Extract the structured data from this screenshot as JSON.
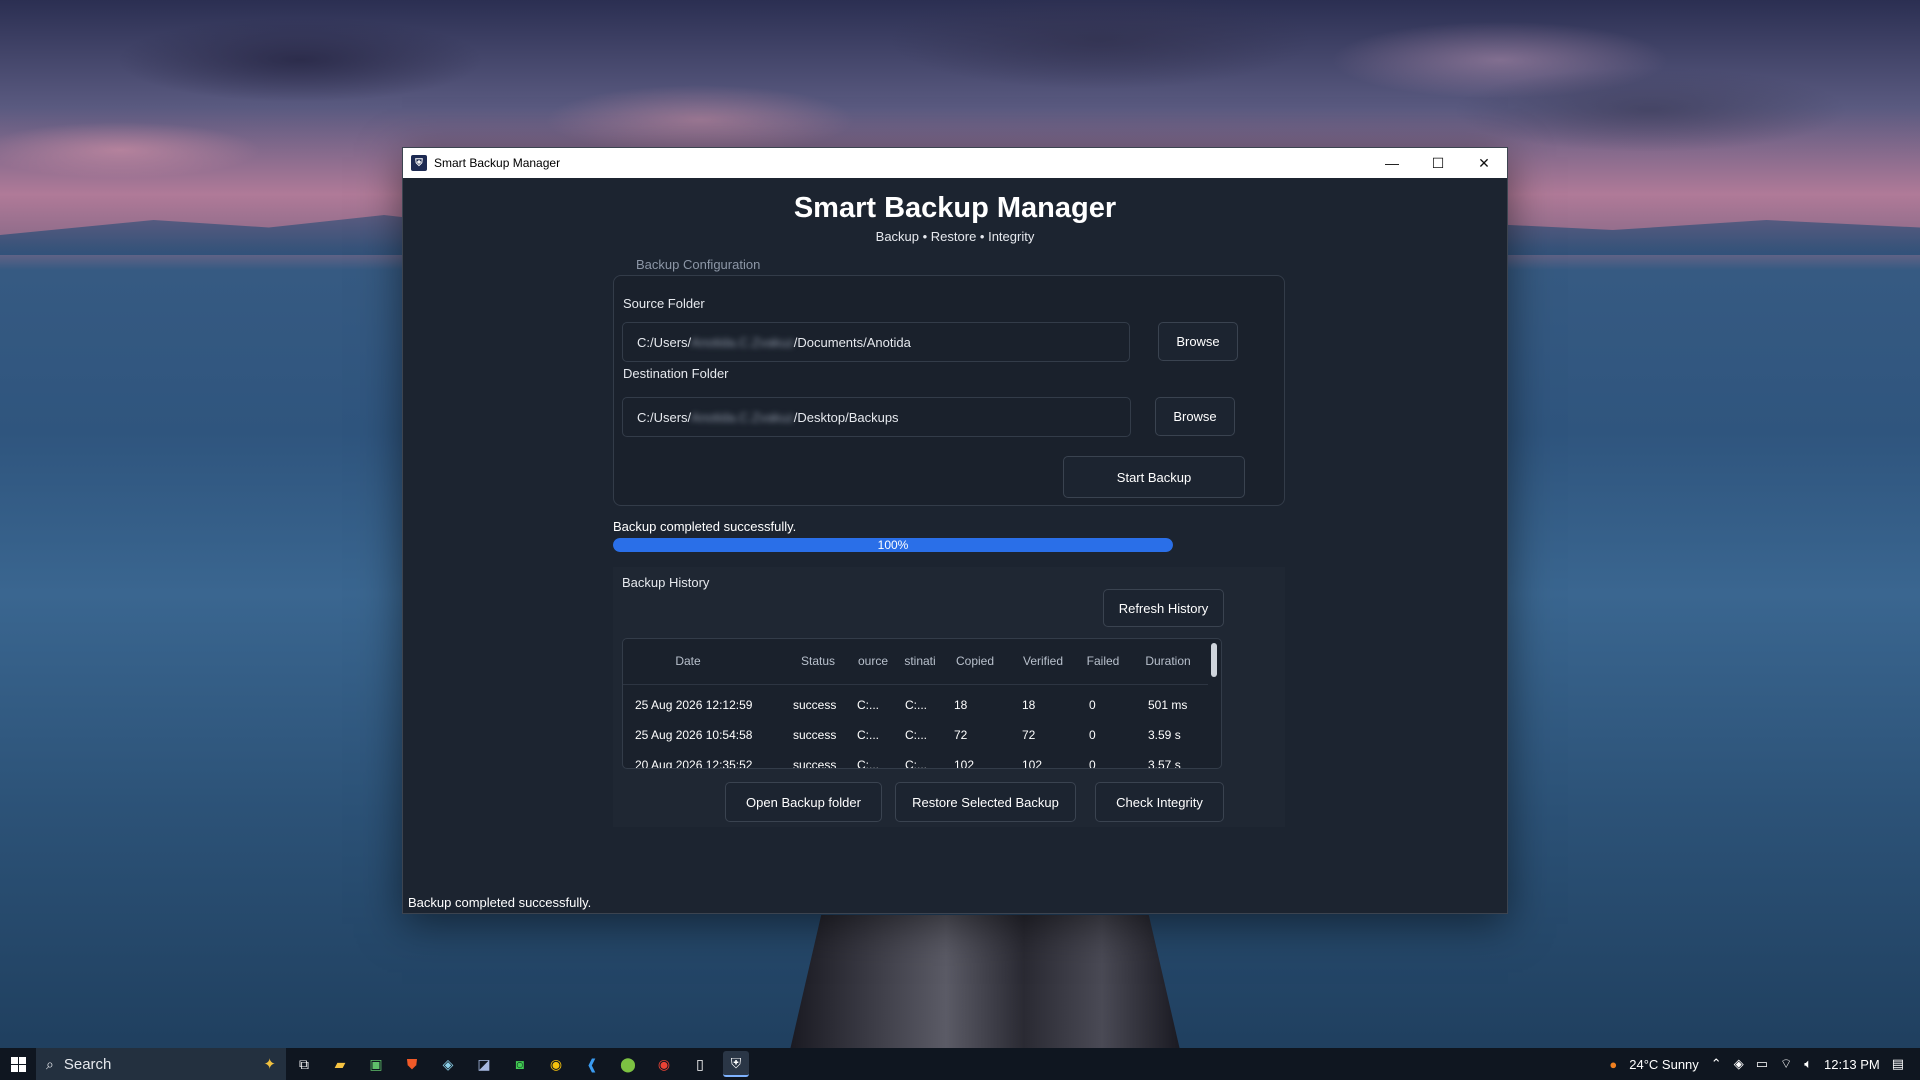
{
  "window": {
    "title": "Smart Backup Manager",
    "controls": {
      "minimize": "—",
      "maximize": "☐",
      "close": "✕"
    }
  },
  "header": {
    "title": "Smart Backup Manager",
    "subtitle": "Backup • Restore • Integrity"
  },
  "config": {
    "section_title": "Backup Configuration",
    "source_label": "Source Folder",
    "source_prefix": "C:/Users/",
    "source_hidden": "Anotida.C.Zvakuz",
    "source_suffix": "/Documents/Anotida",
    "dest_label": "Destination Folder",
    "dest_prefix": "C:/Users/",
    "dest_hidden": "Anotida.C.Zvakuz",
    "dest_suffix": "/Desktop/Backups",
    "browse_label": "Browse",
    "start_label": "Start Backup"
  },
  "progress": {
    "status": "Backup completed successfully.",
    "percent": 100,
    "label": "100%"
  },
  "history": {
    "title": "Backup History",
    "refresh_label": "Refresh History",
    "columns": [
      "Date",
      "Status",
      "ource",
      "stinati",
      "Copied",
      "Verified",
      "Failed",
      "Duration"
    ],
    "rows": [
      {
        "date": "25 Aug 2026 12:12:59",
        "status": "success",
        "source": "C:...",
        "dest": "C:...",
        "copied": "18",
        "verified": "18",
        "failed": "0",
        "duration": "501 ms"
      },
      {
        "date": "25 Aug 2026 10:54:58",
        "status": "success",
        "source": "C:...",
        "dest": "C:...",
        "copied": "72",
        "verified": "72",
        "failed": "0",
        "duration": "3.59 s"
      },
      {
        "date": "20 Aug 2026 12:35:52",
        "status": "success",
        "source": "C:...",
        "dest": "C:...",
        "copied": "102",
        "verified": "102",
        "failed": "0",
        "duration": "3.57 s"
      }
    ],
    "open_folder_label": "Open Backup folder",
    "restore_label": "Restore Selected Backup",
    "integrity_label": "Check Integrity"
  },
  "footer": {
    "status": "Backup completed successfully."
  },
  "taskbar": {
    "search_placeholder": "Search",
    "weather": "24°C  Sunny",
    "time": "12:13 PM"
  }
}
